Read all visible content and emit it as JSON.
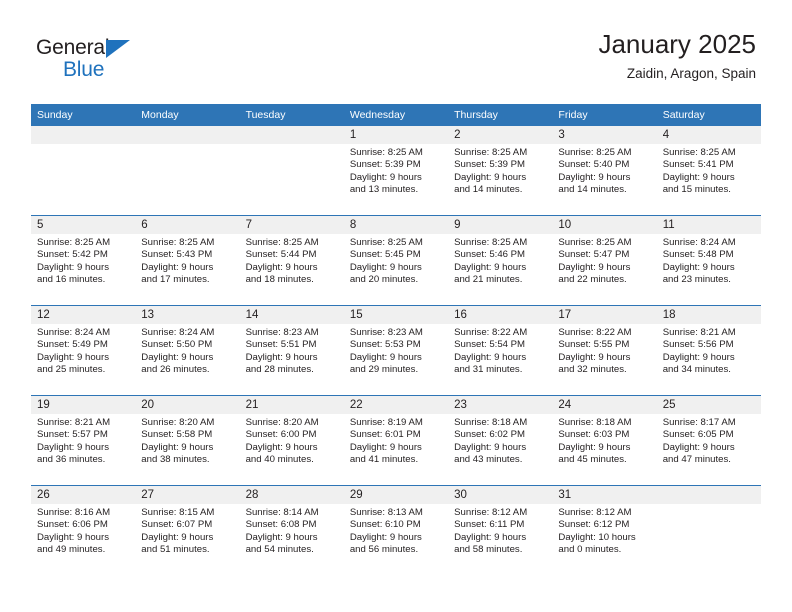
{
  "branding": {
    "name_top": "General",
    "name_bottom": "Blue",
    "triangle_color": "#1f72bd"
  },
  "header": {
    "title": "January 2025",
    "subtitle": "Zaidin, Aragon, Spain"
  },
  "theme": {
    "header_blue": "#2e75b6",
    "date_band_gray": "#f0f0f0",
    "text_color": "#231f20"
  },
  "weekday_headers": [
    "Sunday",
    "Monday",
    "Tuesday",
    "Wednesday",
    "Thursday",
    "Friday",
    "Saturday"
  ],
  "weeks": [
    [
      {
        "date": "",
        "empty": true,
        "sunrise": "",
        "sunset": "",
        "daylight_line1": "",
        "daylight_line2": ""
      },
      {
        "date": "",
        "empty": true,
        "sunrise": "",
        "sunset": "",
        "daylight_line1": "",
        "daylight_line2": ""
      },
      {
        "date": "",
        "empty": true,
        "sunrise": "",
        "sunset": "",
        "daylight_line1": "",
        "daylight_line2": ""
      },
      {
        "date": "1",
        "empty": false,
        "sunrise": "Sunrise: 8:25 AM",
        "sunset": "Sunset: 5:39 PM",
        "daylight_line1": "Daylight: 9 hours",
        "daylight_line2": "and 13 minutes."
      },
      {
        "date": "2",
        "empty": false,
        "sunrise": "Sunrise: 8:25 AM",
        "sunset": "Sunset: 5:39 PM",
        "daylight_line1": "Daylight: 9 hours",
        "daylight_line2": "and 14 minutes."
      },
      {
        "date": "3",
        "empty": false,
        "sunrise": "Sunrise: 8:25 AM",
        "sunset": "Sunset: 5:40 PM",
        "daylight_line1": "Daylight: 9 hours",
        "daylight_line2": "and 14 minutes."
      },
      {
        "date": "4",
        "empty": false,
        "sunrise": "Sunrise: 8:25 AM",
        "sunset": "Sunset: 5:41 PM",
        "daylight_line1": "Daylight: 9 hours",
        "daylight_line2": "and 15 minutes."
      }
    ],
    [
      {
        "date": "5",
        "empty": false,
        "sunrise": "Sunrise: 8:25 AM",
        "sunset": "Sunset: 5:42 PM",
        "daylight_line1": "Daylight: 9 hours",
        "daylight_line2": "and 16 minutes."
      },
      {
        "date": "6",
        "empty": false,
        "sunrise": "Sunrise: 8:25 AM",
        "sunset": "Sunset: 5:43 PM",
        "daylight_line1": "Daylight: 9 hours",
        "daylight_line2": "and 17 minutes."
      },
      {
        "date": "7",
        "empty": false,
        "sunrise": "Sunrise: 8:25 AM",
        "sunset": "Sunset: 5:44 PM",
        "daylight_line1": "Daylight: 9 hours",
        "daylight_line2": "and 18 minutes."
      },
      {
        "date": "8",
        "empty": false,
        "sunrise": "Sunrise: 8:25 AM",
        "sunset": "Sunset: 5:45 PM",
        "daylight_line1": "Daylight: 9 hours",
        "daylight_line2": "and 20 minutes."
      },
      {
        "date": "9",
        "empty": false,
        "sunrise": "Sunrise: 8:25 AM",
        "sunset": "Sunset: 5:46 PM",
        "daylight_line1": "Daylight: 9 hours",
        "daylight_line2": "and 21 minutes."
      },
      {
        "date": "10",
        "empty": false,
        "sunrise": "Sunrise: 8:25 AM",
        "sunset": "Sunset: 5:47 PM",
        "daylight_line1": "Daylight: 9 hours",
        "daylight_line2": "and 22 minutes."
      },
      {
        "date": "11",
        "empty": false,
        "sunrise": "Sunrise: 8:24 AM",
        "sunset": "Sunset: 5:48 PM",
        "daylight_line1": "Daylight: 9 hours",
        "daylight_line2": "and 23 minutes."
      }
    ],
    [
      {
        "date": "12",
        "empty": false,
        "sunrise": "Sunrise: 8:24 AM",
        "sunset": "Sunset: 5:49 PM",
        "daylight_line1": "Daylight: 9 hours",
        "daylight_line2": "and 25 minutes."
      },
      {
        "date": "13",
        "empty": false,
        "sunrise": "Sunrise: 8:24 AM",
        "sunset": "Sunset: 5:50 PM",
        "daylight_line1": "Daylight: 9 hours",
        "daylight_line2": "and 26 minutes."
      },
      {
        "date": "14",
        "empty": false,
        "sunrise": "Sunrise: 8:23 AM",
        "sunset": "Sunset: 5:51 PM",
        "daylight_line1": "Daylight: 9 hours",
        "daylight_line2": "and 28 minutes."
      },
      {
        "date": "15",
        "empty": false,
        "sunrise": "Sunrise: 8:23 AM",
        "sunset": "Sunset: 5:53 PM",
        "daylight_line1": "Daylight: 9 hours",
        "daylight_line2": "and 29 minutes."
      },
      {
        "date": "16",
        "empty": false,
        "sunrise": "Sunrise: 8:22 AM",
        "sunset": "Sunset: 5:54 PM",
        "daylight_line1": "Daylight: 9 hours",
        "daylight_line2": "and 31 minutes."
      },
      {
        "date": "17",
        "empty": false,
        "sunrise": "Sunrise: 8:22 AM",
        "sunset": "Sunset: 5:55 PM",
        "daylight_line1": "Daylight: 9 hours",
        "daylight_line2": "and 32 minutes."
      },
      {
        "date": "18",
        "empty": false,
        "sunrise": "Sunrise: 8:21 AM",
        "sunset": "Sunset: 5:56 PM",
        "daylight_line1": "Daylight: 9 hours",
        "daylight_line2": "and 34 minutes."
      }
    ],
    [
      {
        "date": "19",
        "empty": false,
        "sunrise": "Sunrise: 8:21 AM",
        "sunset": "Sunset: 5:57 PM",
        "daylight_line1": "Daylight: 9 hours",
        "daylight_line2": "and 36 minutes."
      },
      {
        "date": "20",
        "empty": false,
        "sunrise": "Sunrise: 8:20 AM",
        "sunset": "Sunset: 5:58 PM",
        "daylight_line1": "Daylight: 9 hours",
        "daylight_line2": "and 38 minutes."
      },
      {
        "date": "21",
        "empty": false,
        "sunrise": "Sunrise: 8:20 AM",
        "sunset": "Sunset: 6:00 PM",
        "daylight_line1": "Daylight: 9 hours",
        "daylight_line2": "and 40 minutes."
      },
      {
        "date": "22",
        "empty": false,
        "sunrise": "Sunrise: 8:19 AM",
        "sunset": "Sunset: 6:01 PM",
        "daylight_line1": "Daylight: 9 hours",
        "daylight_line2": "and 41 minutes."
      },
      {
        "date": "23",
        "empty": false,
        "sunrise": "Sunrise: 8:18 AM",
        "sunset": "Sunset: 6:02 PM",
        "daylight_line1": "Daylight: 9 hours",
        "daylight_line2": "and 43 minutes."
      },
      {
        "date": "24",
        "empty": false,
        "sunrise": "Sunrise: 8:18 AM",
        "sunset": "Sunset: 6:03 PM",
        "daylight_line1": "Daylight: 9 hours",
        "daylight_line2": "and 45 minutes."
      },
      {
        "date": "25",
        "empty": false,
        "sunrise": "Sunrise: 8:17 AM",
        "sunset": "Sunset: 6:05 PM",
        "daylight_line1": "Daylight: 9 hours",
        "daylight_line2": "and 47 minutes."
      }
    ],
    [
      {
        "date": "26",
        "empty": false,
        "sunrise": "Sunrise: 8:16 AM",
        "sunset": "Sunset: 6:06 PM",
        "daylight_line1": "Daylight: 9 hours",
        "daylight_line2": "and 49 minutes."
      },
      {
        "date": "27",
        "empty": false,
        "sunrise": "Sunrise: 8:15 AM",
        "sunset": "Sunset: 6:07 PM",
        "daylight_line1": "Daylight: 9 hours",
        "daylight_line2": "and 51 minutes."
      },
      {
        "date": "28",
        "empty": false,
        "sunrise": "Sunrise: 8:14 AM",
        "sunset": "Sunset: 6:08 PM",
        "daylight_line1": "Daylight: 9 hours",
        "daylight_line2": "and 54 minutes."
      },
      {
        "date": "29",
        "empty": false,
        "sunrise": "Sunrise: 8:13 AM",
        "sunset": "Sunset: 6:10 PM",
        "daylight_line1": "Daylight: 9 hours",
        "daylight_line2": "and 56 minutes."
      },
      {
        "date": "30",
        "empty": false,
        "sunrise": "Sunrise: 8:12 AM",
        "sunset": "Sunset: 6:11 PM",
        "daylight_line1": "Daylight: 9 hours",
        "daylight_line2": "and 58 minutes."
      },
      {
        "date": "31",
        "empty": false,
        "sunrise": "Sunrise: 8:12 AM",
        "sunset": "Sunset: 6:12 PM",
        "daylight_line1": "Daylight: 10 hours",
        "daylight_line2": "and 0 minutes."
      },
      {
        "date": "",
        "empty": true,
        "sunrise": "",
        "sunset": "",
        "daylight_line1": "",
        "daylight_line2": ""
      }
    ]
  ]
}
